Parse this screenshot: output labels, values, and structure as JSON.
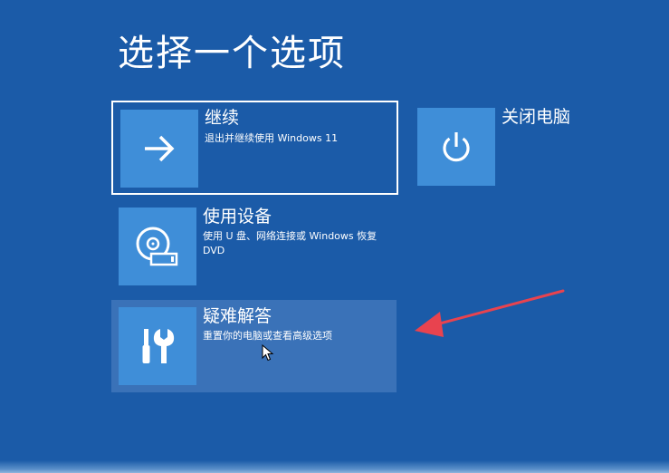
{
  "screen": {
    "title": "选择一个选项",
    "background_color": "#1b5ba8",
    "tile_icon_color": "#3f8ed8",
    "hover_tile_color": "#3a72b8",
    "annotation_color": "#e8434f"
  },
  "options": [
    {
      "title": "继续",
      "description": "退出并继续使用 Windows 11",
      "icon": "arrow-right-icon",
      "state": "focused"
    },
    {
      "title": "使用设备",
      "description": "使用 U 盘、网络连接或 Windows 恢复 DVD",
      "icon": "disc-drive-icon"
    },
    {
      "title": "疑难解答",
      "description": "重置你的电脑或查看高级选项",
      "icon": "tools-icon",
      "state": "hovered"
    }
  ],
  "power_option": {
    "label": "关闭电脑",
    "icon": "power-icon"
  }
}
